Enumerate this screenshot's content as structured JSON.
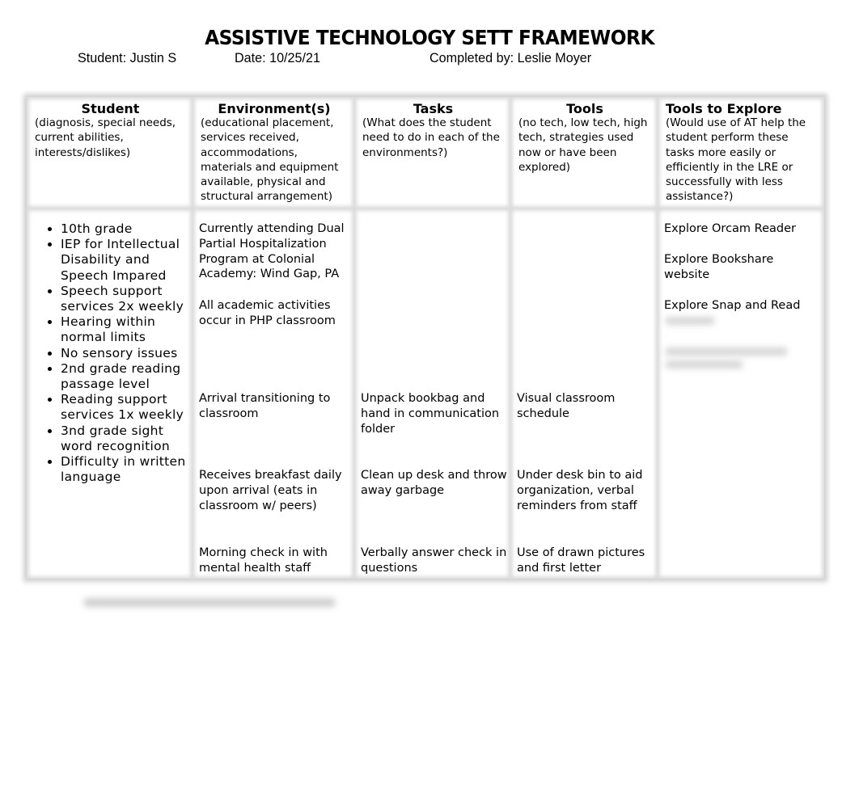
{
  "document": {
    "title": "ASSISTIVE TECHNOLOGY SETT FRAMEWORK",
    "student_line": "Student: Justin S",
    "date_line": "Date: 10/25/21",
    "completed_by_line": "Completed by: Leslie Moyer"
  },
  "table": {
    "headers": [
      {
        "title": "Student",
        "subtitle": "(diagnosis, special needs, current abilities, interests/dislikes)"
      },
      {
        "title": "Environment(s)",
        "subtitle": "(educational placement, services received, accommodations, materials and equipment available, physical and structural arrangement)"
      },
      {
        "title": "Tasks",
        "subtitle": "(What does the student need to do in each of the environments?)"
      },
      {
        "title": "Tools",
        "subtitle": "(no tech, low tech, high tech, strategies used now or have been explored)"
      },
      {
        "title": "Tools to Explore",
        "subtitle": "(Would use of AT help the student perform these tasks more easily or efficiently in the LRE or successfully with less assistance?)"
      }
    ],
    "student_bullets": [
      "10th grade",
      "IEP for Intellectual Disability and Speech Impared",
      "Speech support services 2x weekly",
      "Hearing within normal limits",
      "No sensory issues",
      "2nd grade reading passage level",
      "Reading support services 1x weekly",
      "3nd grade sight word recognition",
      "Difficulty in written language"
    ],
    "environments": [
      "Currently attending Dual Partial Hospitalization Program at Colonial Academy: Wind Gap, PA",
      "All academic activities occur in PHP classroom",
      "Arrival transitioning to classroom",
      "Receives breakfast daily upon arrival (eats in classroom w/ peers)",
      "Morning check in with mental health staff"
    ],
    "tasks": [
      "Unpack bookbag and hand in communication folder",
      "Clean up desk and throw away garbage",
      "Verbally answer check in questions"
    ],
    "tools": [
      "Visual classroom schedule",
      "Under desk bin to aid organization, verbal reminders from staff",
      "Use of drawn pictures and first letter"
    ],
    "tools_to_explore": [
      "Explore Orcam Reader",
      "Explore Bookshare website",
      "Explore Snap and Read"
    ]
  }
}
